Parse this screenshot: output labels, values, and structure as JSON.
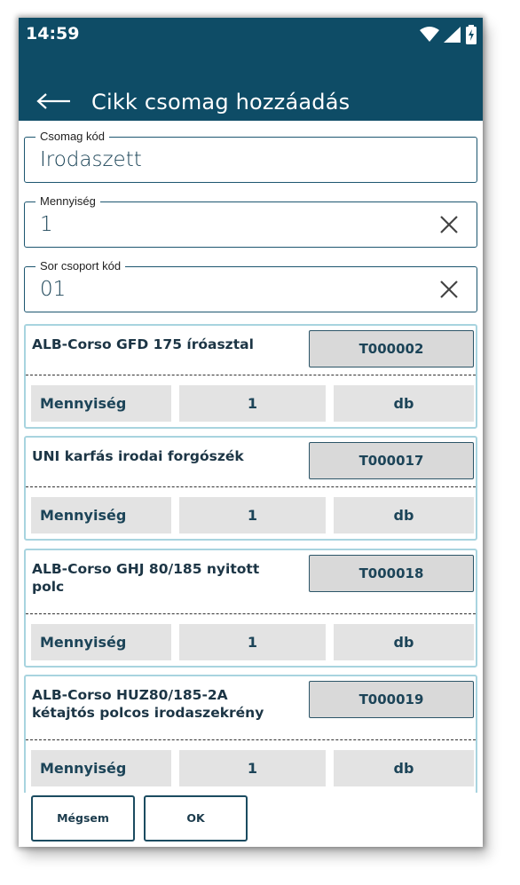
{
  "status": {
    "time": "14:59"
  },
  "header": {
    "title": "Cikk csomag hozzáadás"
  },
  "fields": [
    {
      "label": "Csomag kód",
      "value": "Irodaszett",
      "clearable": false
    },
    {
      "label": "Mennyiség",
      "value": "1",
      "clearable": true
    },
    {
      "label": "Sor csoport kód",
      "value": "01",
      "clearable": true
    }
  ],
  "items": [
    {
      "name": "ALB-Corso GFD 175 íróasztal",
      "code": "T000002",
      "qty_label": "Mennyiség",
      "qty": "1",
      "unit": "db"
    },
    {
      "name": "UNI karfás irodai forgószék",
      "code": "T000017",
      "qty_label": "Mennyiség",
      "qty": "1",
      "unit": "db"
    },
    {
      "name": "ALB-Corso GHJ 80/185 nyitott polc",
      "code": "T000018",
      "qty_label": "Mennyiség",
      "qty": "1",
      "unit": "db"
    },
    {
      "name": "ALB-Corso HUZ80/185-2A kétajtós polcos irodaszekrény",
      "code": "T000019",
      "qty_label": "Mennyiség",
      "qty": "1",
      "unit": "db"
    }
  ],
  "footer": {
    "cancel_label": "Mégsem",
    "ok_label": "OK"
  },
  "colors": {
    "header": "#0e4c66",
    "card_border": "#a8d4df",
    "code_button": "#d9d9d9",
    "qty_cell": "#e3e3e3"
  },
  "icons": {
    "back": "arrow-left-icon",
    "clear": "close-icon",
    "wifi": "wifi-icon",
    "signal": "signal-icon",
    "battery": "battery-charging-icon"
  }
}
